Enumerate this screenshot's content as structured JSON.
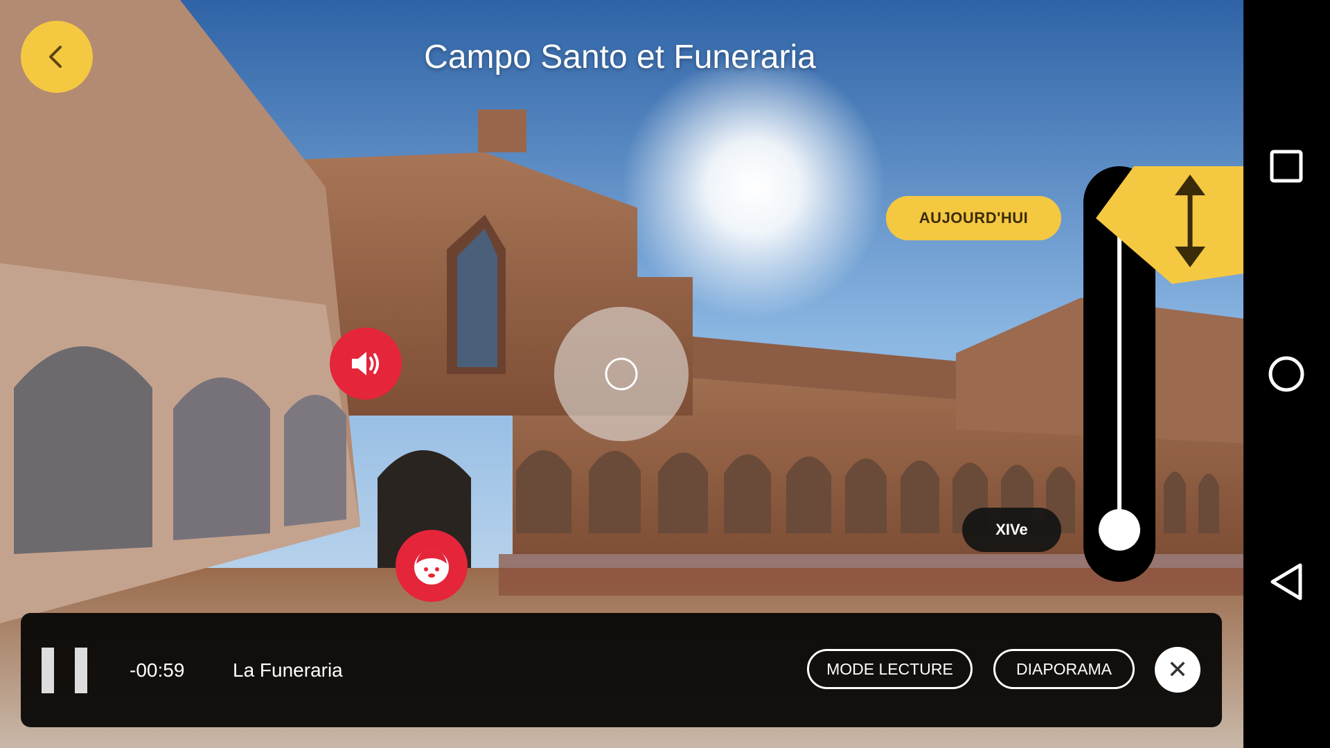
{
  "title": "Campo Santo et Funeraria",
  "icons": {
    "back": "chevron-left-icon",
    "audio": "speaker-icon",
    "guide": "character-face-icon",
    "focus": "circle-target-icon",
    "drag": "vertical-arrows-icon",
    "close": "close-icon",
    "nav_recents": "square-icon",
    "nav_home": "circle-icon",
    "nav_back": "triangle-back-icon"
  },
  "timeline": {
    "top_label": "AUJOURD'HUI",
    "bottom_label": "XIVe",
    "position": 0
  },
  "player": {
    "time": "-00:59",
    "track_title": "La Funeraria",
    "mode_button": "MODE LECTURE",
    "slideshow_button": "DIAPORAMA",
    "close_symbol": "✕"
  },
  "colors": {
    "accent_yellow": "#f5c842",
    "hotspot_red": "#e5253a",
    "bar_background": "#000000"
  }
}
